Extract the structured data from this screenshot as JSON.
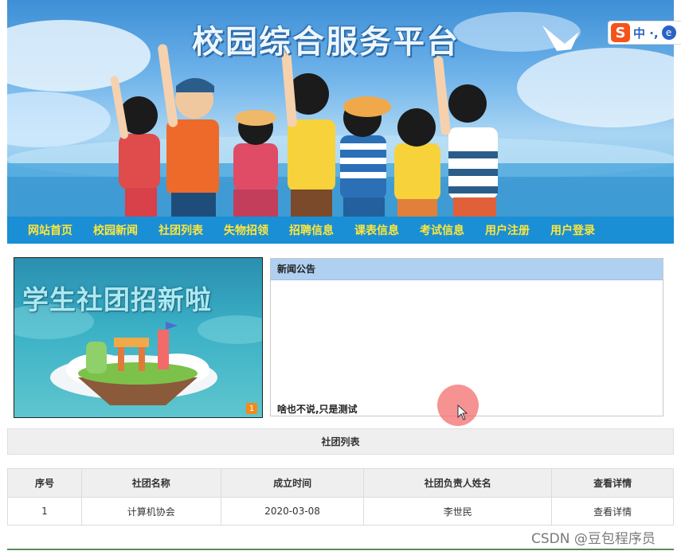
{
  "header": {
    "site_title": "校园综合服务平台",
    "ime": {
      "logo": "S",
      "text": "中 ·,",
      "extra": "e"
    }
  },
  "nav": {
    "items": [
      {
        "label": "网站首页"
      },
      {
        "label": "校园新闻"
      },
      {
        "label": "社团列表"
      },
      {
        "label": "失物招领"
      },
      {
        "label": "招聘信息"
      },
      {
        "label": "课表信息"
      },
      {
        "label": "考试信息"
      },
      {
        "label": "用户注册"
      },
      {
        "label": "用户登录"
      }
    ]
  },
  "slideshow": {
    "title": "学生社团招新啦",
    "current_index": "1"
  },
  "news": {
    "heading": "新闻公告",
    "content": "啥也不说,只是测试"
  },
  "club_list": {
    "title": "社团列表",
    "columns": [
      "序号",
      "社团名称",
      "成立时间",
      "社团负责人姓名",
      "查看详情"
    ],
    "rows": [
      [
        "1",
        "计算机协会",
        "2020-03-08",
        "李世民",
        "查看详情"
      ]
    ]
  },
  "watermark": "CSDN @豆包程序员",
  "colors": {
    "nav_bg": "#1a8fd5",
    "nav_text": "#ffe63a",
    "news_header": "#b0d0f2"
  }
}
